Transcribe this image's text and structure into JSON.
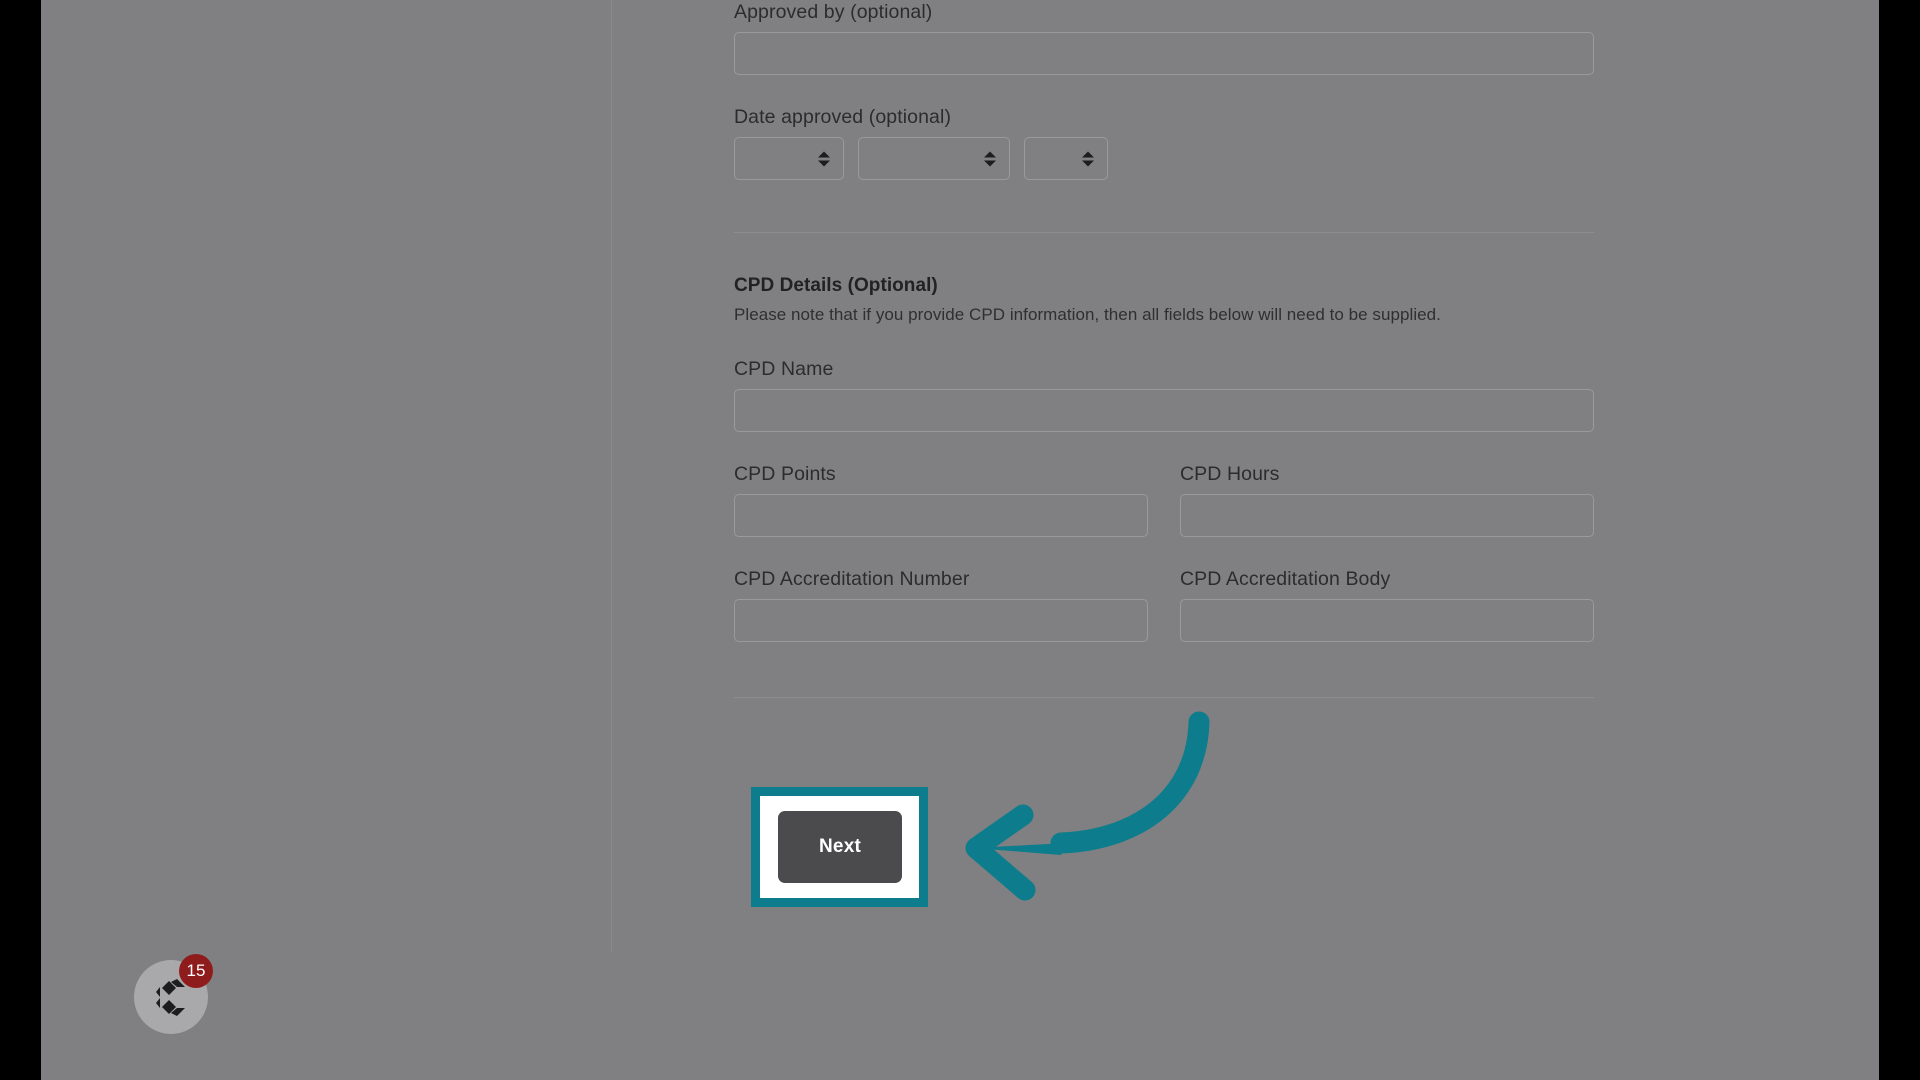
{
  "form": {
    "approved_by": {
      "label": "Approved by (optional)",
      "value": "",
      "placeholder": ""
    },
    "date_approved": {
      "label": "Date approved (optional)",
      "selects": [
        {
          "name": "day",
          "value": ""
        },
        {
          "name": "month",
          "value": ""
        },
        {
          "name": "year",
          "value": ""
        }
      ]
    },
    "cpd_section": {
      "title": "CPD Details (Optional)",
      "note": "Please note that if you provide CPD information, then all fields below will need to be supplied.",
      "fields": [
        {
          "label": "CPD Name",
          "value": "",
          "placeholder": ""
        },
        {
          "label": "CPD Points",
          "value": "",
          "placeholder": ""
        },
        {
          "label": "CPD Hours",
          "value": "",
          "placeholder": ""
        },
        {
          "label": "CPD Accreditation Number",
          "value": "",
          "placeholder": ""
        },
        {
          "label": "CPD Accreditation Body",
          "value": "",
          "placeholder": ""
        }
      ]
    },
    "submit": {
      "next_label": "Next"
    }
  },
  "chat_widget": {
    "badge_count": "15",
    "icon": "chat-logo-icon"
  },
  "colors": {
    "highlight_teal": "#0d7c8c",
    "button_gray": "#4b4b4d",
    "badge_red": "#8f1c1c",
    "scrim_gray": "#808082"
  }
}
